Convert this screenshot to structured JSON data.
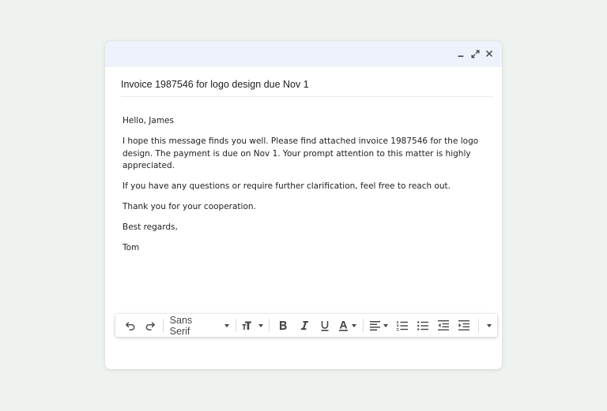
{
  "email": {
    "subject": "Invoice 1987546 for logo design due Nov 1",
    "greeting": "Hello, James",
    "paragraph1": "I hope this message finds you well. Please find attached invoice 1987546 for the logo design. The payment is due on Nov 1. Your prompt attention to this matter is highly appreciated.",
    "paragraph2": "If you have any questions or require further clarification, feel free to reach out.",
    "thanks": "Thank you for your cooperation.",
    "closing": "Best regards,",
    "signature": "Tom"
  },
  "toolbar": {
    "font_family": "Sans Serif"
  },
  "colors": {
    "background": "#eef3ef",
    "titlebar": "#edf2fb",
    "icon": "#444746"
  },
  "icons": {
    "window": [
      "minimize-icon",
      "expand-icon",
      "close-icon"
    ],
    "toolbar": [
      "undo-icon",
      "redo-icon",
      "font-size-icon",
      "bold-icon",
      "italic-icon",
      "underline-icon",
      "text-color-icon",
      "align-icon",
      "numbered-list-icon",
      "bulleted-list-icon",
      "indent-less-icon",
      "indent-more-icon",
      "more-options-icon"
    ]
  }
}
